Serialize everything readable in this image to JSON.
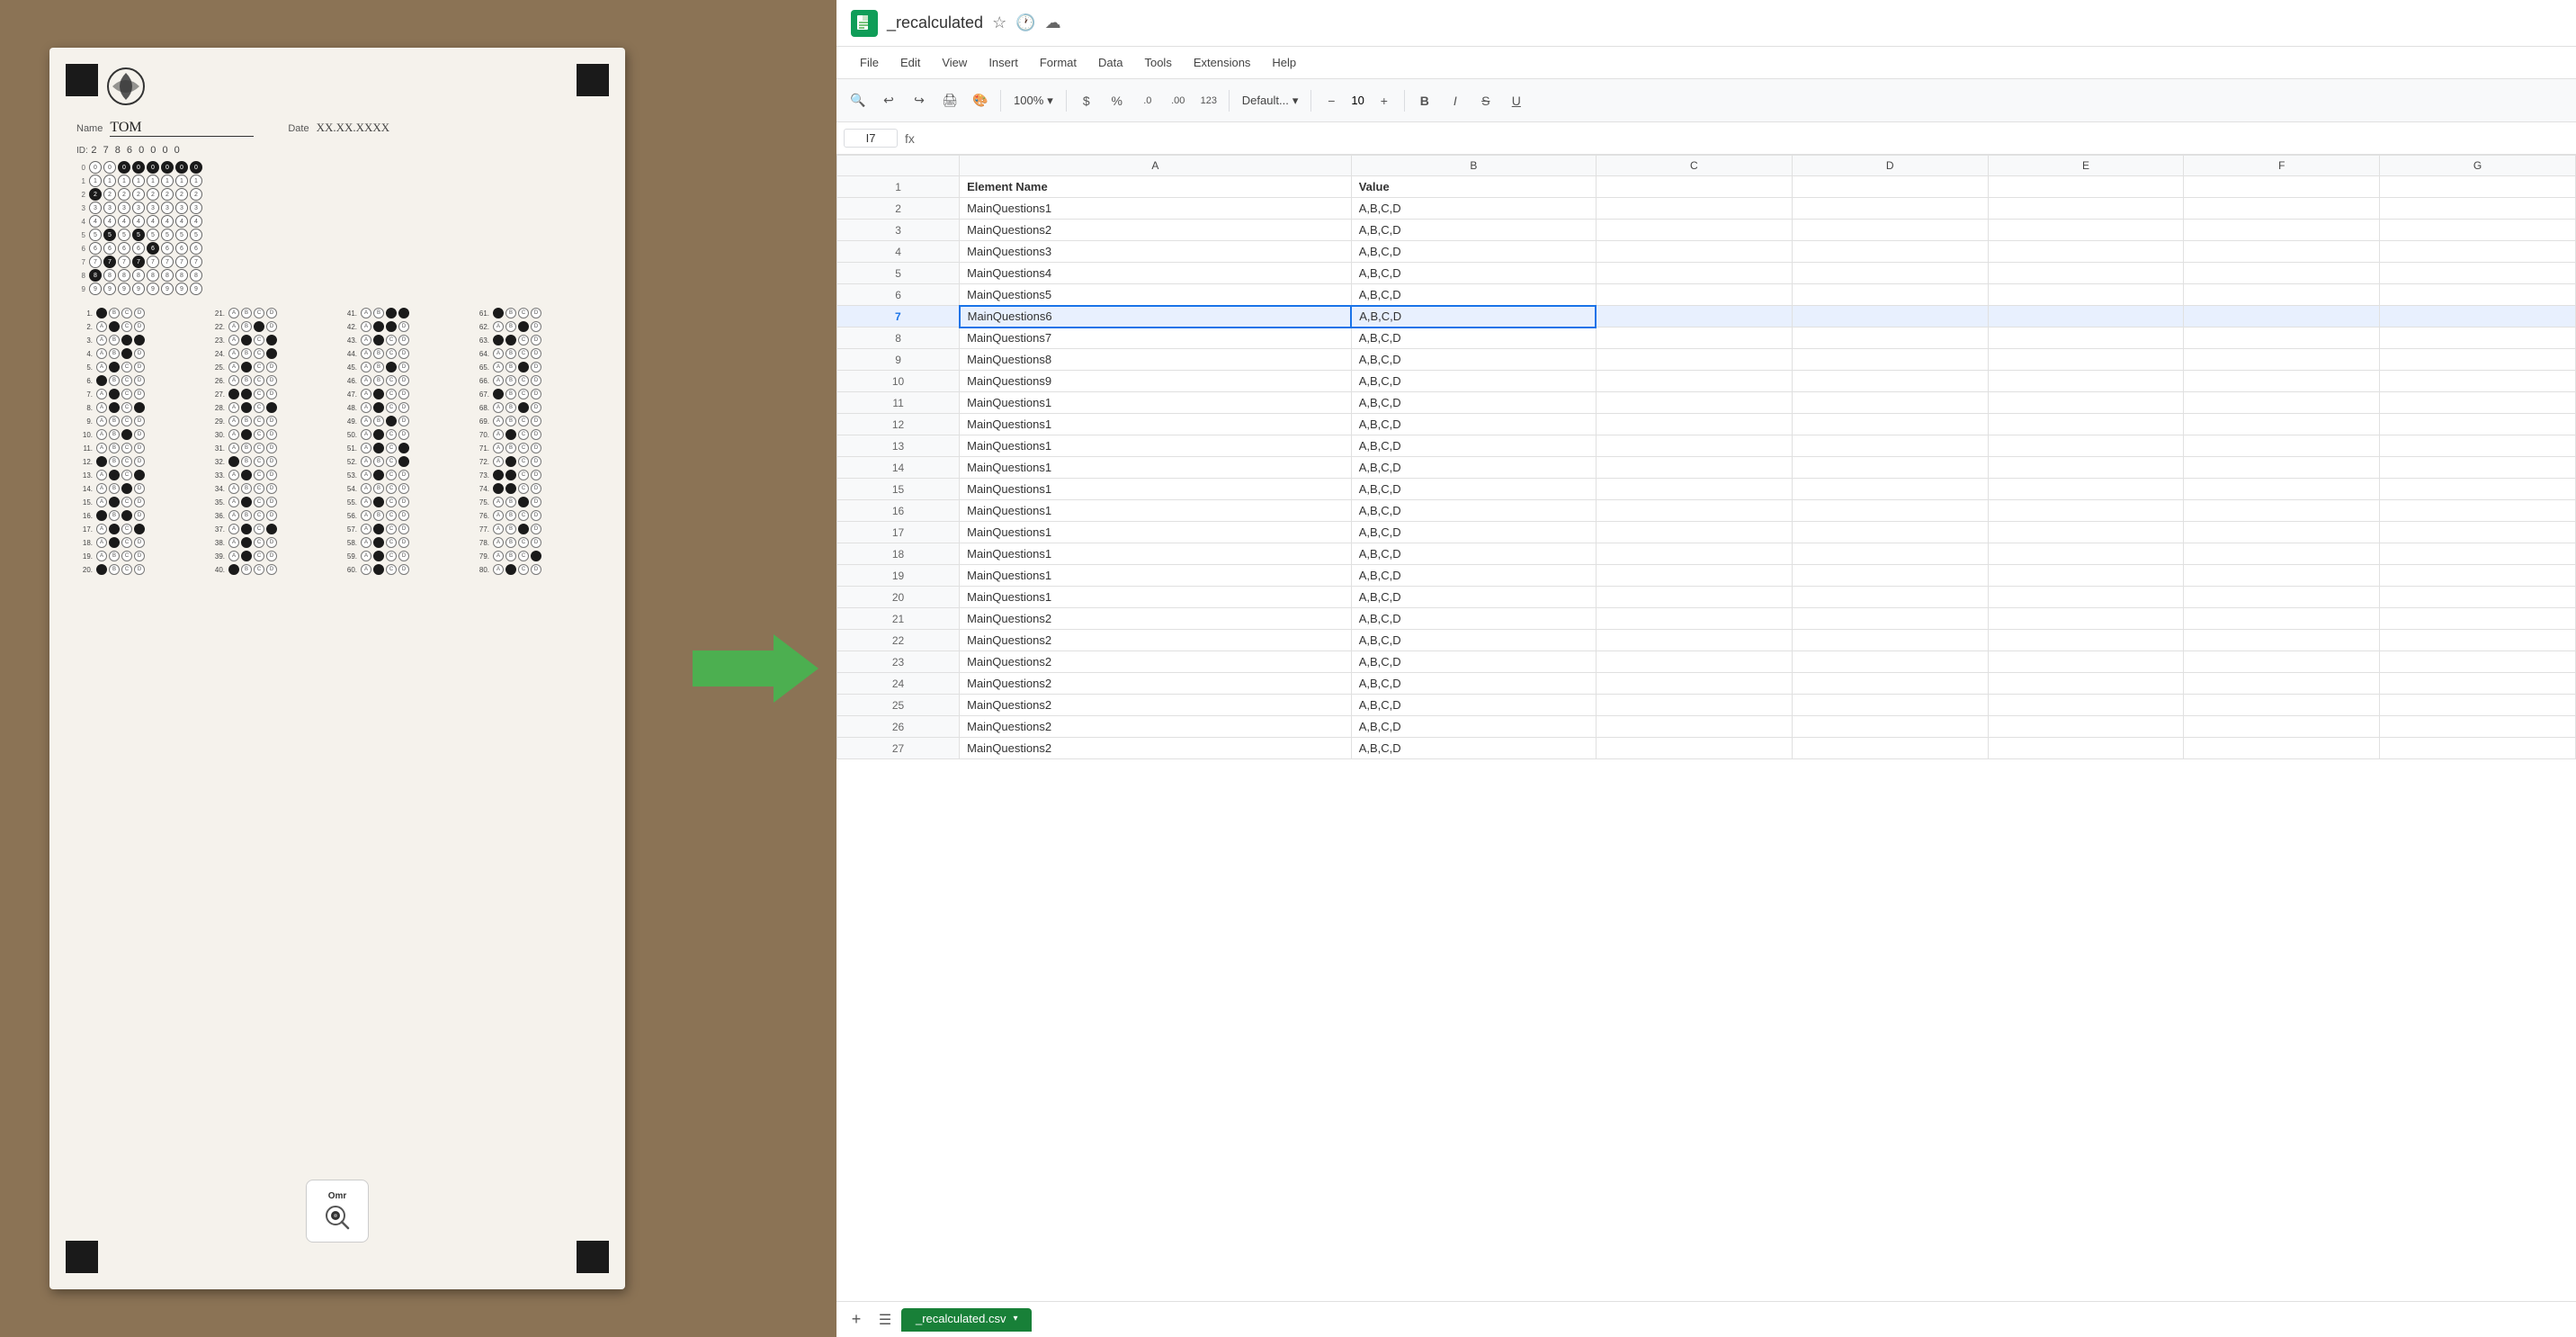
{
  "left": {
    "student_name": "TOM",
    "date": "XX.XX.XXXX",
    "id_label": "ID:",
    "id_digits": "2 7 8 6 0 0 0 0",
    "app_icon_text": "Omr"
  },
  "arrow": {
    "color": "#4CAF50"
  },
  "spreadsheet": {
    "title": "_recalculated",
    "cell_ref": "I7",
    "tabs": [
      {
        "label": "_recalculated.csv"
      }
    ],
    "menu": {
      "file": "File",
      "edit": "Edit",
      "view": "View",
      "insert": "Insert",
      "format": "Format",
      "data": "Data",
      "tools": "Tools",
      "extensions": "Extensions",
      "help": "Help"
    },
    "toolbar": {
      "zoom": "100%",
      "currency": "$",
      "percent": "%",
      "decimal_more": ".0",
      "decimal_less": ".00",
      "format_number": "123",
      "font": "Default...",
      "font_size": "10",
      "bold": "B",
      "italic": "I",
      "strikethrough": "S",
      "underline": "U"
    },
    "columns": [
      "",
      "A",
      "B",
      "C",
      "D",
      "E",
      "F",
      "G"
    ],
    "headers": {
      "col_a": "Element Name",
      "col_b": "Value"
    },
    "rows": [
      {
        "num": 1,
        "a": "Element Name",
        "b": "Value"
      },
      {
        "num": 2,
        "a": "MainQuestions1",
        "b": "A,B,C,D"
      },
      {
        "num": 3,
        "a": "MainQuestions2",
        "b": "A,B,C,D"
      },
      {
        "num": 4,
        "a": "MainQuestions3",
        "b": "A,B,C,D"
      },
      {
        "num": 5,
        "a": "MainQuestions4",
        "b": "A,B,C,D"
      },
      {
        "num": 6,
        "a": "MainQuestions5",
        "b": "A,B,C,D"
      },
      {
        "num": 7,
        "a": "MainQuestions6",
        "b": "A,B,C,D",
        "selected": true
      },
      {
        "num": 8,
        "a": "MainQuestions7",
        "b": "A,B,C,D"
      },
      {
        "num": 9,
        "a": "MainQuestions8",
        "b": "A,B,C,D"
      },
      {
        "num": 10,
        "a": "MainQuestions9",
        "b": "A,B,C,D"
      },
      {
        "num": 11,
        "a": "MainQuestions1",
        "b": "A,B,C,D"
      },
      {
        "num": 12,
        "a": "MainQuestions1",
        "b": "A,B,C,D"
      },
      {
        "num": 13,
        "a": "MainQuestions1",
        "b": "A,B,C,D"
      },
      {
        "num": 14,
        "a": "MainQuestions1",
        "b": "A,B,C,D"
      },
      {
        "num": 15,
        "a": "MainQuestions1",
        "b": "A,B,C,D"
      },
      {
        "num": 16,
        "a": "MainQuestions1",
        "b": "A,B,C,D"
      },
      {
        "num": 17,
        "a": "MainQuestions1",
        "b": "A,B,C,D"
      },
      {
        "num": 18,
        "a": "MainQuestions1",
        "b": "A,B,C,D"
      },
      {
        "num": 19,
        "a": "MainQuestions1",
        "b": "A,B,C,D"
      },
      {
        "num": 20,
        "a": "MainQuestions1",
        "b": "A,B,C,D"
      },
      {
        "num": 21,
        "a": "MainQuestions2",
        "b": "A,B,C,D"
      },
      {
        "num": 22,
        "a": "MainQuestions2",
        "b": "A,B,C,D"
      },
      {
        "num": 23,
        "a": "MainQuestions2",
        "b": "A,B,C,D"
      },
      {
        "num": 24,
        "a": "MainQuestions2",
        "b": "A,B,C,D"
      },
      {
        "num": 25,
        "a": "MainQuestions2",
        "b": "A,B,C,D"
      },
      {
        "num": 26,
        "a": "MainQuestions2",
        "b": "A,B,C,D"
      },
      {
        "num": 27,
        "a": "MainQuestions2",
        "b": "A,B,C,D"
      }
    ]
  }
}
